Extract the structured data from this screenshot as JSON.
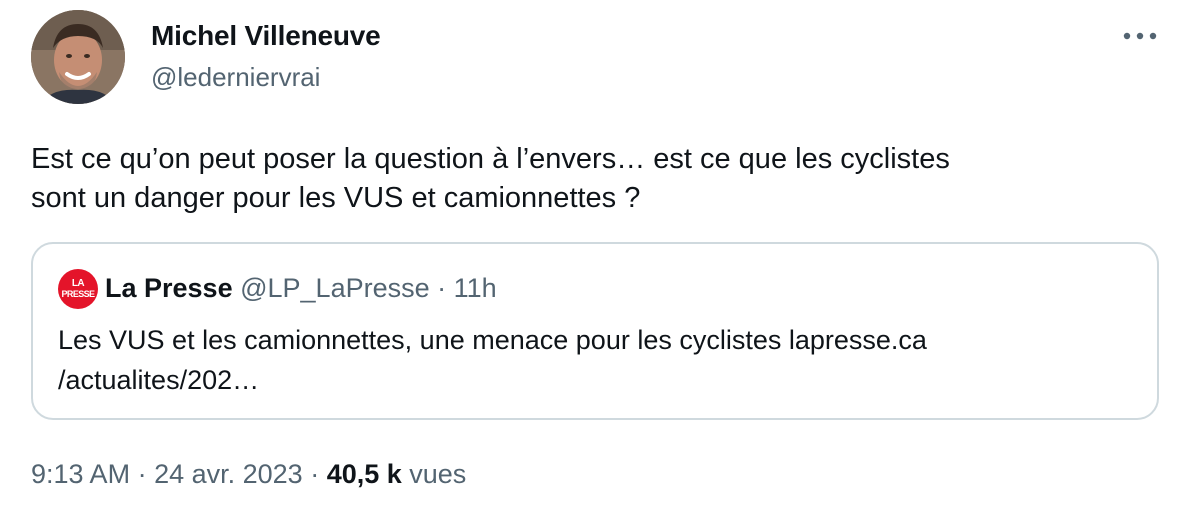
{
  "author": {
    "name": "Michel Villeneuve",
    "handle": "@ledernierv rai"
  },
  "tweet": {
    "text_line1": "Est ce qu’on peut poser la question à l’envers… est ce que les cyclistes",
    "text_line2": "sont un danger pour les VUS et camionnettes ?"
  },
  "quoted": {
    "logo_top": "LA",
    "logo_bottom": "PRESSE",
    "name": "La Presse",
    "handle": "@LP_LaPresse",
    "separator": " · ",
    "time": "11h",
    "text_line1": "Les VUS et les camionnettes, une menace pour les cyclistes lapresse.ca",
    "text_line2": "/actualites/202…"
  },
  "footer": {
    "time": "9:13 AM",
    "sep1": " · ",
    "date": "24 avr. 2023",
    "sep2": " · ",
    "views_count": "40,5 k",
    "views_label": " vues"
  },
  "icons": {
    "more": "more-horizontal-icon",
    "avatar": "avatar-photo"
  },
  "colors": {
    "text": "#0f1419",
    "secondary": "#536471",
    "border": "#cfd9de",
    "brand_red": "#e4142a"
  }
}
